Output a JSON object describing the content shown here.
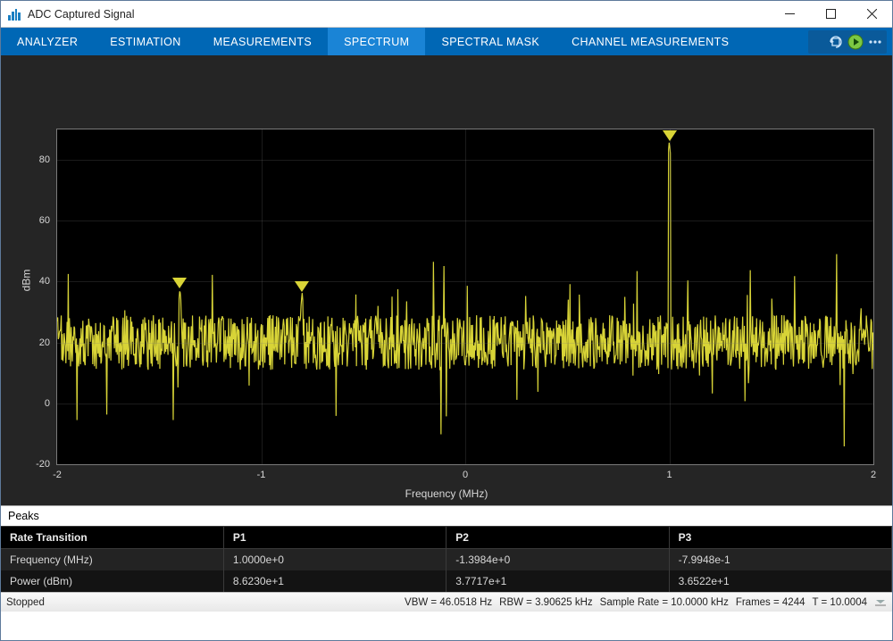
{
  "window": {
    "title": "ADC Captured Signal"
  },
  "ribbon": {
    "tabs": [
      {
        "label": "ANALYZER"
      },
      {
        "label": "ESTIMATION"
      },
      {
        "label": "MEASUREMENTS"
      },
      {
        "label": "SPECTRUM"
      },
      {
        "label": "SPECTRAL MASK"
      },
      {
        "label": "CHANNEL MEASUREMENTS"
      }
    ]
  },
  "chart_data": {
    "type": "line",
    "title": "",
    "xlabel": "Frequency (MHz)",
    "ylabel": "dBm",
    "xlim": [
      -2,
      2
    ],
    "ylim": [
      -20,
      90
    ],
    "xticks": [
      -2,
      -1,
      0,
      1,
      2
    ],
    "yticks": [
      -20,
      0,
      20,
      40,
      60,
      80
    ],
    "series_note": "dense noisy spectrum, visually ~20 dBm mean noise floor with spikes",
    "markers": [
      {
        "label": "P1",
        "x": 1.0,
        "y": 86.23
      },
      {
        "label": "P2",
        "x": -1.3984,
        "y": 37.717
      },
      {
        "label": "P3",
        "x": -0.79948,
        "y": 36.522
      }
    ]
  },
  "peaks": {
    "title": "Peaks",
    "headers": [
      "Rate Transition",
      "P1",
      "P2",
      "P3"
    ],
    "rows": [
      {
        "label": "Frequency (MHz)",
        "p1": "1.0000e+0",
        "p2": "-1.3984e+0",
        "p3": "-7.9948e-1"
      },
      {
        "label": "Power (dBm)",
        "p1": "8.6230e+1",
        "p2": "3.7717e+1",
        "p3": "3.6522e+1"
      }
    ]
  },
  "status": {
    "state": "Stopped",
    "vbw": "VBW = 46.0518 Hz",
    "rbw": "RBW = 3.90625 kHz",
    "sample_rate": "Sample Rate = 10.0000 kHz",
    "frames": "Frames = 4244",
    "t": "T = 10.0004"
  }
}
